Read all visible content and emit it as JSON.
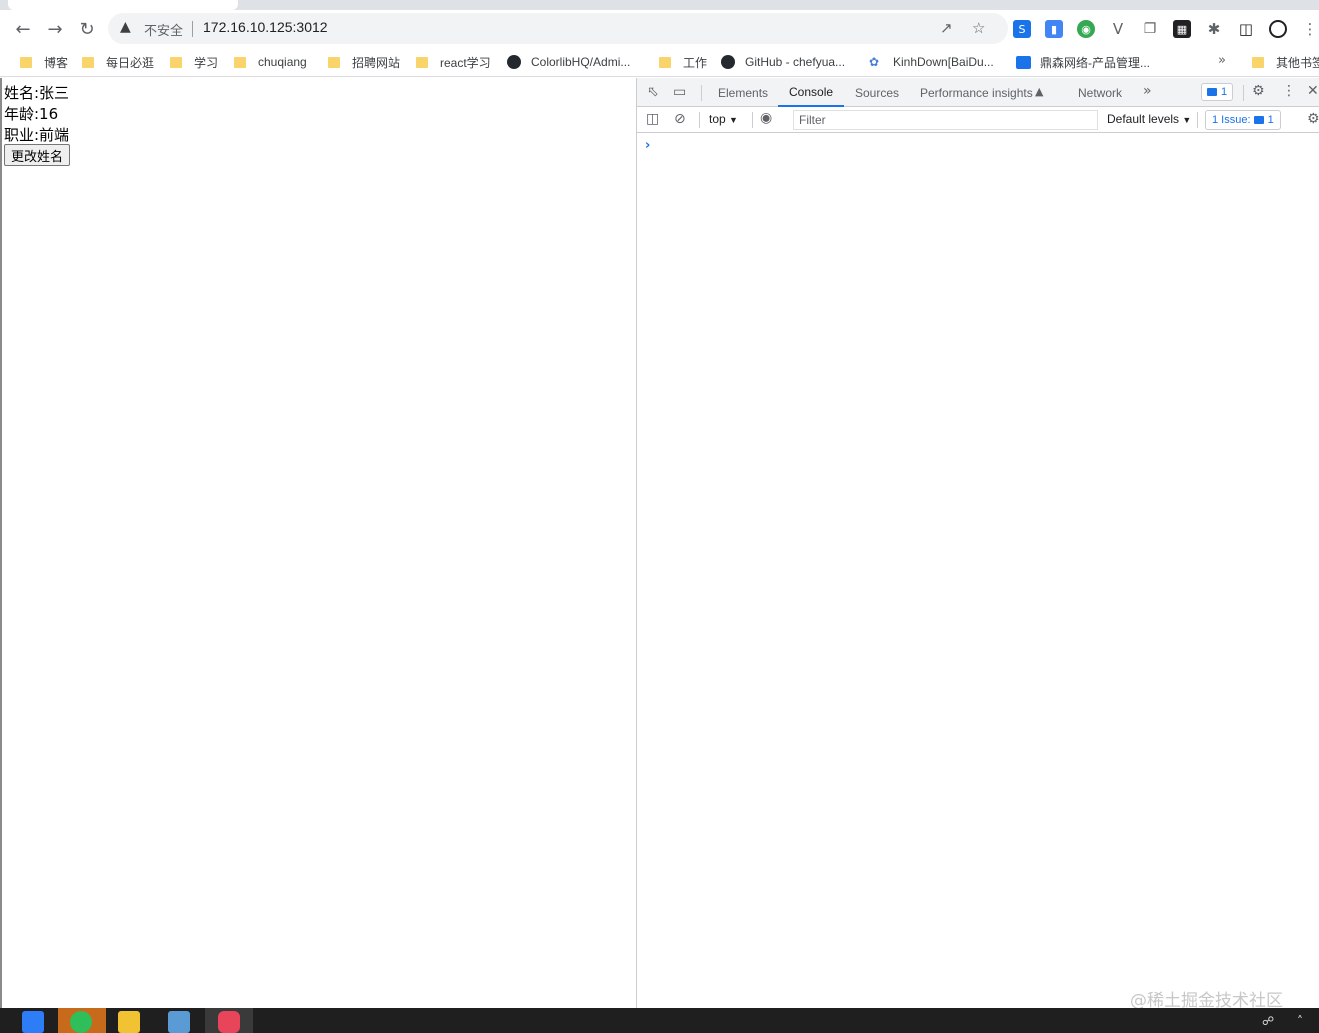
{
  "browser": {
    "omnibox": {
      "security_label": "不安全",
      "url": "172.16.10.125:3012"
    },
    "bookmarks": [
      {
        "label": "博客",
        "icon": "folder-icon"
      },
      {
        "label": "每日必逛",
        "icon": "folder-icon"
      },
      {
        "label": "学习",
        "icon": "folder-icon"
      },
      {
        "label": "chuqiang",
        "icon": "folder-icon"
      },
      {
        "label": "招聘网站",
        "icon": "folder-icon"
      },
      {
        "label": "react学习",
        "icon": "folder-icon"
      },
      {
        "label": "ColorlibHQ/Admi...",
        "icon": "github-icon"
      },
      {
        "label": "工作",
        "icon": "folder-icon"
      },
      {
        "label": "GitHub - chefyua...",
        "icon": "github-icon"
      },
      {
        "label": "KinhDown[BaiDu...",
        "icon": "site-icon"
      },
      {
        "label": "鼎森网络-产品管理...",
        "icon": "site-icon"
      }
    ],
    "other_bookmarks": "其他书签"
  },
  "page": {
    "name_line": "姓名:张三",
    "age_line": "年龄:16",
    "job_line": "职业:前端",
    "change_name_button": "更改姓名"
  },
  "devtools": {
    "tabs": [
      {
        "label": "Elements"
      },
      {
        "label": "Console"
      },
      {
        "label": "Sources"
      },
      {
        "label": "Performance insights"
      },
      {
        "label": "Network"
      }
    ],
    "active_tab": "Console",
    "message_badge_count": "1",
    "console_toolbar": {
      "context": "top",
      "filter_placeholder": "Filter",
      "levels": "Default levels",
      "issues_label": "1 Issue:",
      "issues_count": "1"
    },
    "prompt_symbol": "›"
  },
  "watermark": "@稀土掘金技术社区",
  "colors": {
    "accent": "#1a73e8",
    "folder": "#f9d46b",
    "devtools_bg": "#f1f3f4"
  }
}
